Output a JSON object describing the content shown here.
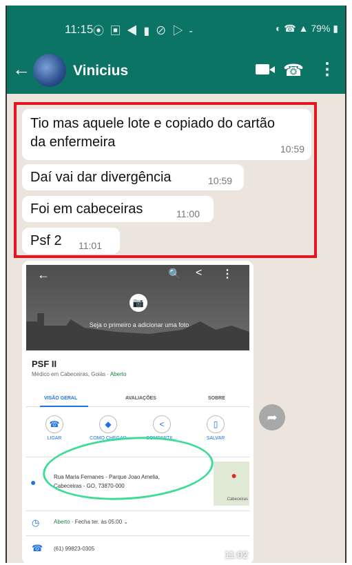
{
  "status_bar": {
    "time": "11:15",
    "icons": "⦿ ▣ ◀ ▮ ⊘ ▷ -",
    "right": "◐ ☎ ▲ 79% ▮"
  },
  "header": {
    "back": "←",
    "contact_name": "Vinicius",
    "phone_icon": "☎",
    "menu_icon": "⋮"
  },
  "messages": [
    {
      "text": "Tio mas aquele lote e copiado do cartão da enfermeira",
      "time": "10:59"
    },
    {
      "text": "Daí vai dar divergência",
      "time": "10:59"
    },
    {
      "text": "Foi em cabeceiras",
      "time": "11:00"
    },
    {
      "text": "Psf 2",
      "time": "11:01"
    }
  ],
  "image_message": {
    "time": "11:02",
    "maps": {
      "photo_hint": "Seja o primeiro a adicionar uma foto",
      "place_name": "PSF II",
      "category": "Médico em Cabeceiras, Goiás",
      "open_status": "Aberto",
      "tabs": [
        "VISÃO GERAL",
        "AVALIAÇÕES",
        "SOBRE"
      ],
      "actions": [
        "LIGAR",
        "COMO CHEGAR",
        "COMPARTIL...",
        "SALVAR"
      ],
      "address": "Rua Maria Fernanes - Parque Joao Amelia, Cabeceiras - GO, 73870-000",
      "map_label": "Cabeceiras",
      "hours_open": "Aberto",
      "hours_close": "· Fecha ter. às 05:00",
      "phone": "(61) 99823-0305"
    }
  },
  "colors": {
    "header_green": "#0b7465",
    "highlight_red": "#e5141e",
    "annotation_green": "#3ddc97",
    "chat_bg": "#ece5dd"
  },
  "icons": {
    "forward": "forward-icon",
    "video": "video-call-icon",
    "call": "phone-icon"
  }
}
